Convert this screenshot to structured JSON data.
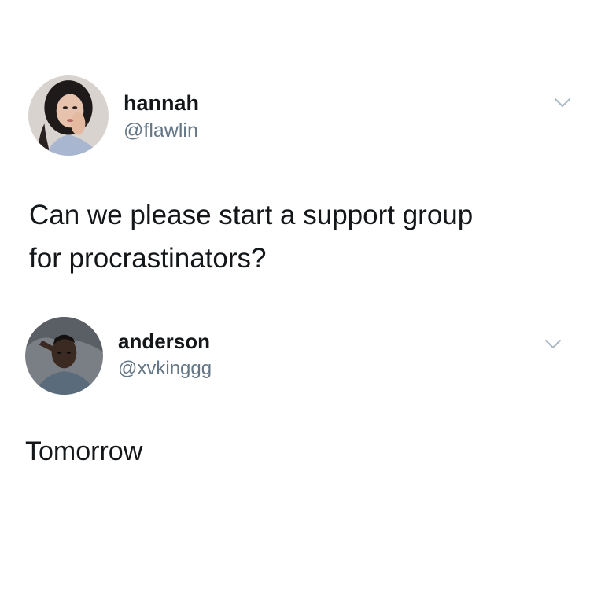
{
  "tweets": [
    {
      "user": {
        "display_name": "hannah",
        "handle": "@flawlin",
        "avatar_icon": "avatar-hannah"
      },
      "text": "Can we please start a support group\nfor procrastinators?",
      "menu_icon": "chevron-down-icon"
    },
    {
      "user": {
        "display_name": "anderson",
        "handle": "@xvkinggg",
        "avatar_icon": "avatar-anderson"
      },
      "text": "Tomorrow",
      "menu_icon": "chevron-down-icon"
    }
  ],
  "colors": {
    "name": "#14171a",
    "handle": "#657786",
    "caret": "#aab8c2",
    "background": "#ffffff"
  }
}
